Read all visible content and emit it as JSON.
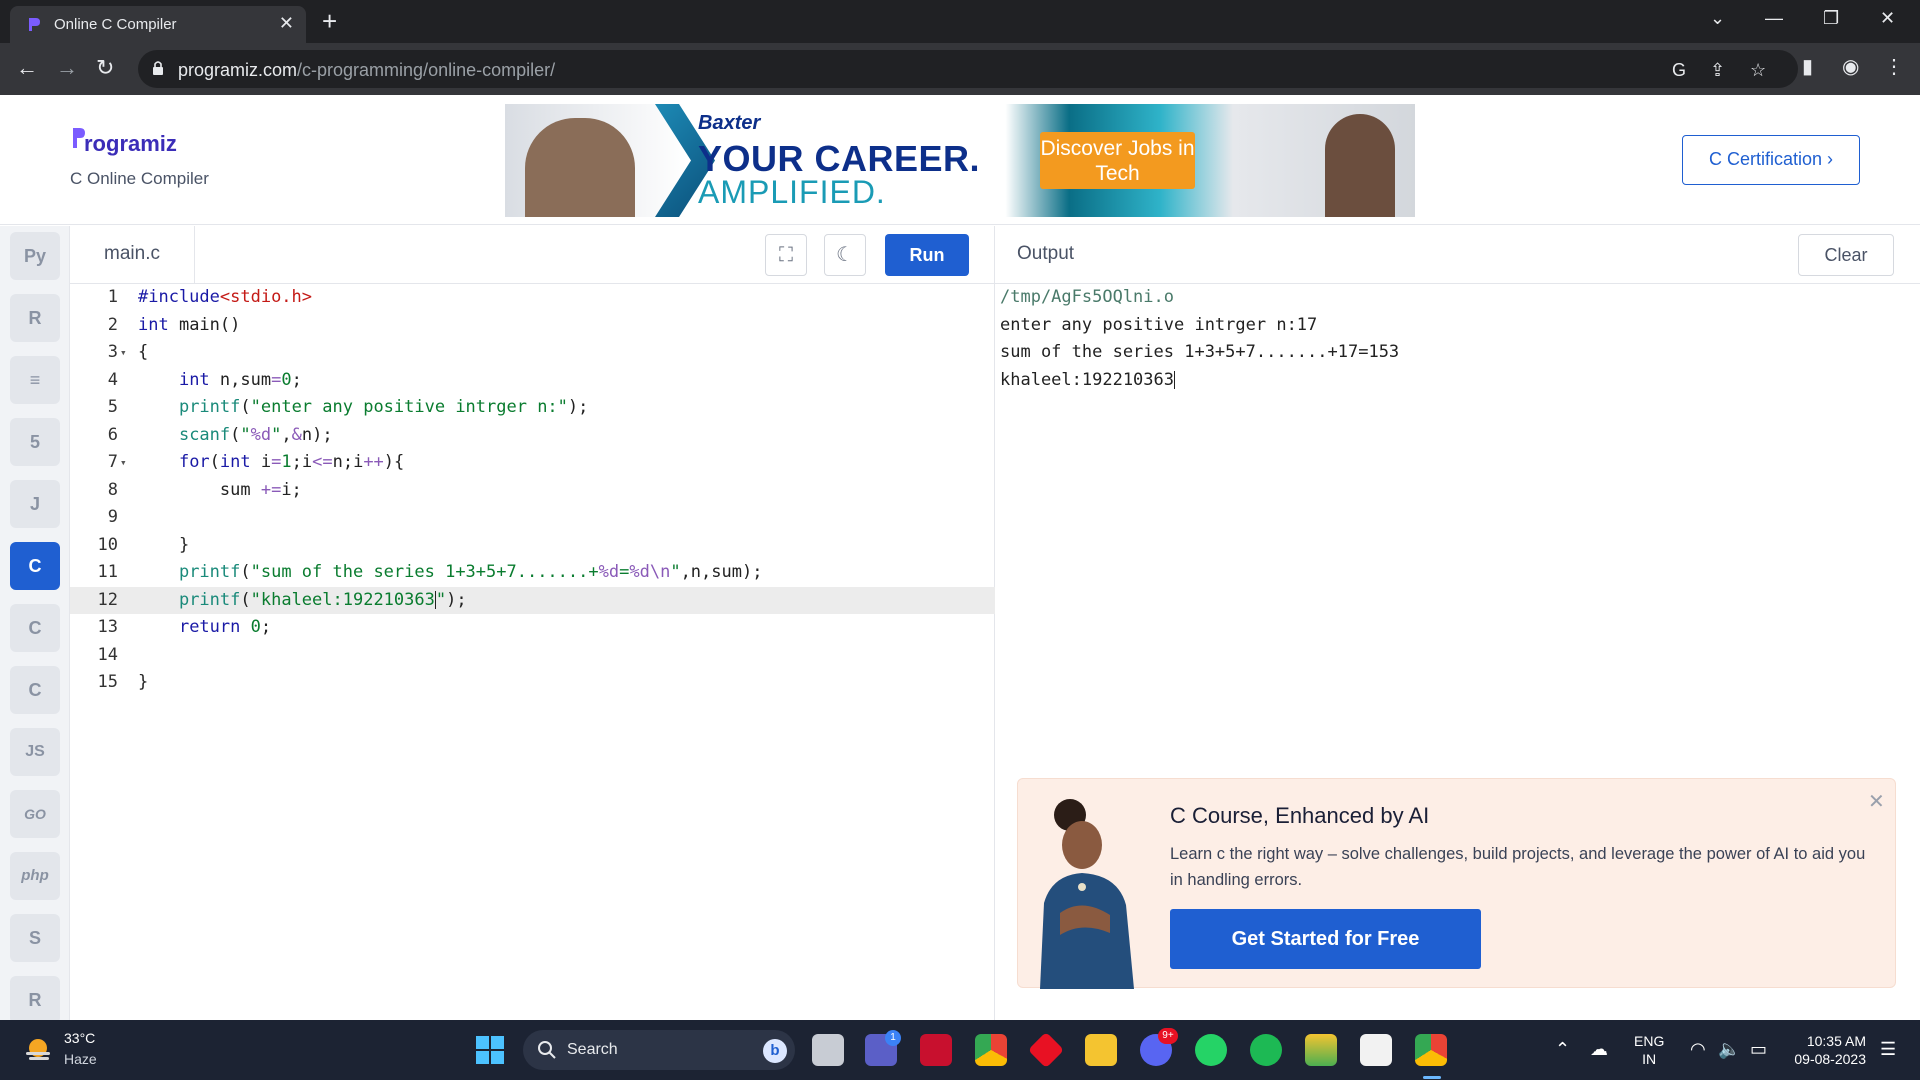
{
  "browser": {
    "tab_title": "Online C Compiler",
    "url_host": "programiz.com",
    "url_path": "/c-programming/online-compiler/"
  },
  "header": {
    "logo_text": "rogramiz",
    "subtitle": "C Online Compiler",
    "certification_label": "C Certification ›"
  },
  "banner": {
    "brand": "Baxter",
    "line1": "YOUR CAREER.",
    "line2": "AMPLIFIED.",
    "cta": "Discover Jobs in Tech"
  },
  "languages": [
    {
      "name": "python",
      "glyph": "Py"
    },
    {
      "name": "r",
      "glyph": "R"
    },
    {
      "name": "sql",
      "glyph": "≡"
    },
    {
      "name": "html",
      "glyph": "5"
    },
    {
      "name": "java",
      "glyph": "J"
    },
    {
      "name": "c",
      "glyph": "C",
      "active": true
    },
    {
      "name": "cpp",
      "glyph": "C"
    },
    {
      "name": "csharp",
      "glyph": "C"
    },
    {
      "name": "javascript",
      "glyph": "JS"
    },
    {
      "name": "go",
      "glyph": "GO"
    },
    {
      "name": "php",
      "glyph": "php"
    },
    {
      "name": "swift",
      "glyph": "S"
    },
    {
      "name": "rust",
      "glyph": "R"
    }
  ],
  "editor": {
    "file_name": "main.c",
    "run_label": "Run",
    "active_line": 12,
    "lines": [
      {
        "no": "1",
        "text": "#include<stdio.h>"
      },
      {
        "no": "2",
        "text": "int main()"
      },
      {
        "no": "3",
        "text": "{"
      },
      {
        "no": "4",
        "text": "    int n,sum=0;"
      },
      {
        "no": "5",
        "text": "    printf(\"enter any positive intrger n:\");"
      },
      {
        "no": "6",
        "text": "    scanf(\"%d\",&n);"
      },
      {
        "no": "7",
        "text": "    for(int i=1;i<=n;i++){"
      },
      {
        "no": "8",
        "text": "        sum +=i;"
      },
      {
        "no": "9",
        "text": ""
      },
      {
        "no": "10",
        "text": "    }"
      },
      {
        "no": "11",
        "text": "    printf(\"sum of the series 1+3+5+7.......+%d=%d\\n\",n,sum);"
      },
      {
        "no": "12",
        "text": "    printf(\"khaleel:192210363\");"
      },
      {
        "no": "13",
        "text": "    return 0;"
      },
      {
        "no": "14",
        "text": ""
      },
      {
        "no": "15",
        "text": "}"
      }
    ]
  },
  "output": {
    "title": "Output",
    "clear_label": "Clear",
    "lines": [
      "/tmp/AgFs5OQlni.o",
      "enter any positive intrger n:17",
      "sum of the series 1+3+5+7.......+17=153",
      "khaleel:192210363"
    ]
  },
  "promo": {
    "title": "C Course, Enhanced by AI",
    "description": "Learn c the right way – solve challenges, build projects, and leverage the power of AI to aid you in handling errors.",
    "button": "Get Started for Free"
  },
  "taskbar": {
    "temperature": "33°C",
    "condition": "Haze",
    "search_label": "Search",
    "language_top": "ENG",
    "language_bottom": "IN",
    "time": "10:35 AM",
    "date": "09-08-2023",
    "teams_badge": "1",
    "discord_badge": "9+"
  },
  "colors": {
    "accent": "#1f5fd1",
    "brand_purple": "#3b2db8",
    "taskbar_bg": "#1c2333",
    "promo_bg": "#fdeee6"
  }
}
